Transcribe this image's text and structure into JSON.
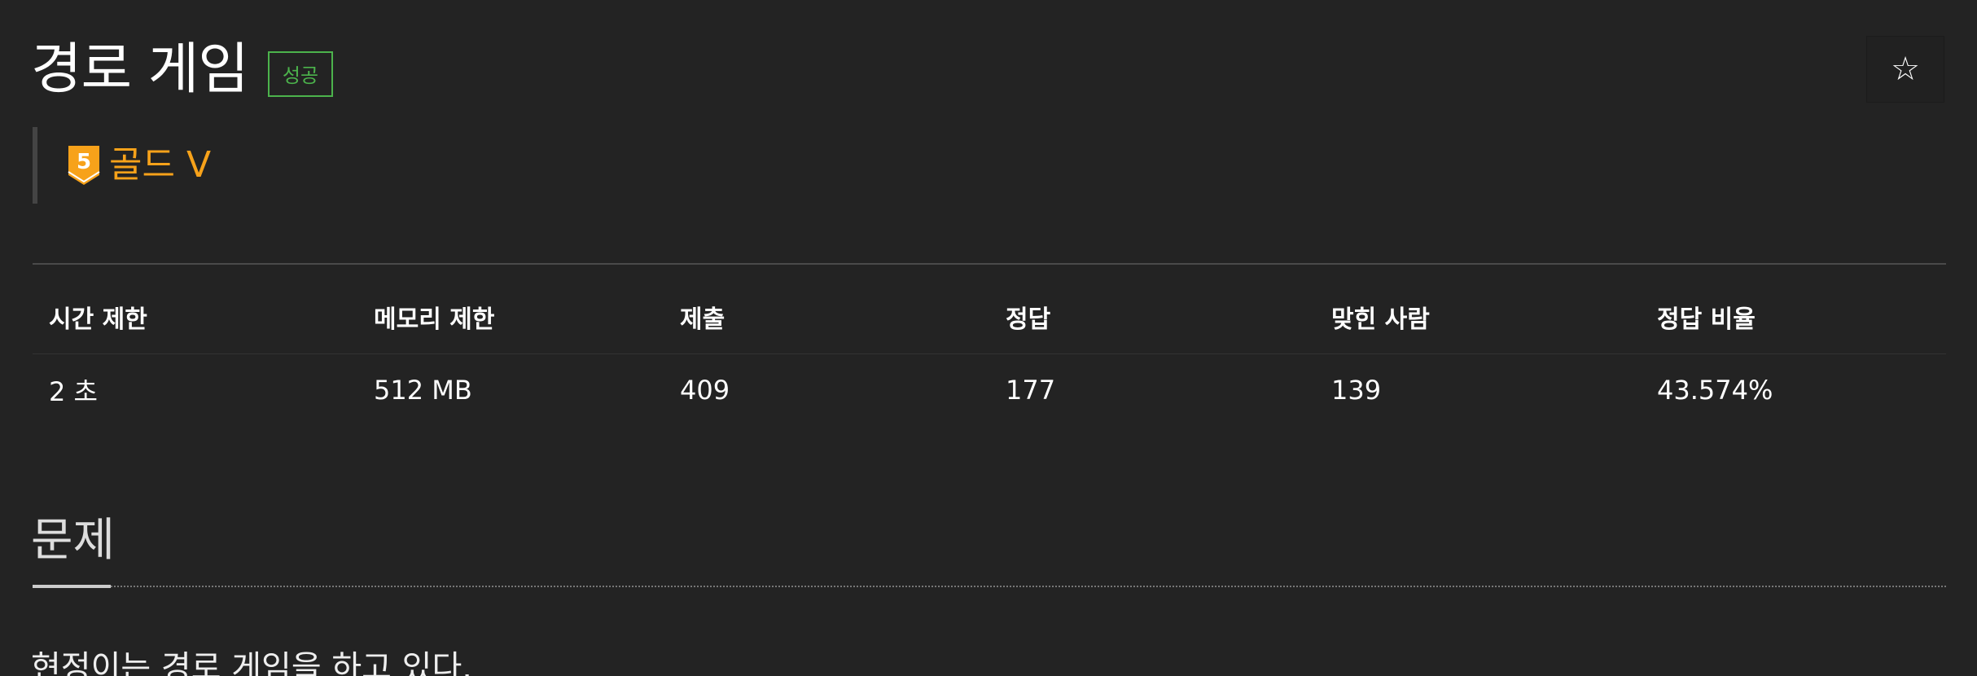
{
  "problem": {
    "title": "경로 게임",
    "result_badge": "성공",
    "tier": {
      "icon": "gold-tier-badge-icon",
      "number": "5",
      "label": "골드 V",
      "color": "#f7a21a"
    },
    "star_icon": "☆"
  },
  "stats": {
    "headers": [
      "시간 제한",
      "메모리 제한",
      "제출",
      "정답",
      "맞힌 사람",
      "정답 비율"
    ],
    "values": [
      "2 초",
      "512 MB",
      "409",
      "177",
      "139",
      "43.574%"
    ]
  },
  "section": {
    "title": "문제",
    "description": "현정이는 경로 게임을 하고 있다."
  },
  "colors": {
    "background": "#232323",
    "success": "#4cb34c",
    "gold": "#f7a21a"
  }
}
